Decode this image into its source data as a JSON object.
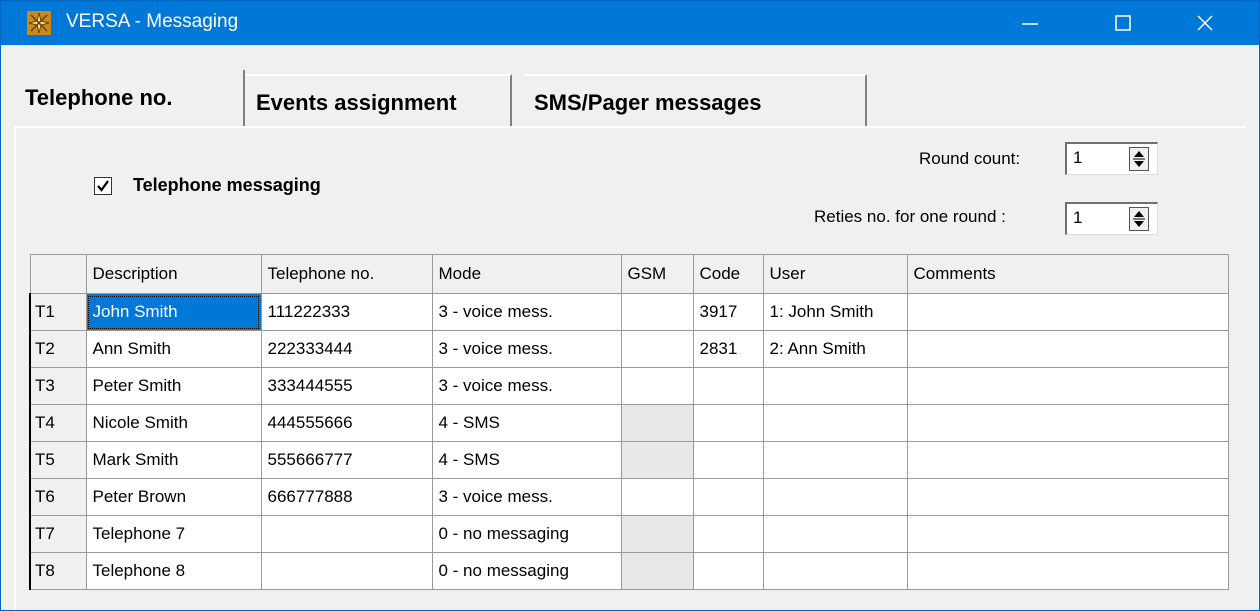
{
  "window": {
    "title": "VERSA - Messaging",
    "icon": "versa-app-icon",
    "controls": [
      "minimize-icon",
      "maximize-icon",
      "close-icon"
    ]
  },
  "tabs": [
    {
      "label": "Telephone no.",
      "active": true
    },
    {
      "label": "Events assignment",
      "active": false
    },
    {
      "label": "SMS/Pager messages",
      "active": false
    }
  ],
  "telephone_messaging": {
    "label": "Telephone messaging",
    "checked": true
  },
  "round_count": {
    "label": "Round count:",
    "value": "1"
  },
  "retries": {
    "label": "Reties no. for one round :",
    "value": "1"
  },
  "table": {
    "columns": [
      "",
      "Description",
      "Telephone no.",
      "Mode",
      "GSM",
      "Code",
      "User",
      "Comments"
    ],
    "rows": [
      {
        "id": "T1",
        "description": "John Smith",
        "phone": "111222333",
        "mode": "3 - voice mess.",
        "gsm": "",
        "code": "3917",
        "user": "1: John Smith",
        "comments": ""
      },
      {
        "id": "T2",
        "description": "Ann Smith",
        "phone": "222333444",
        "mode": "3 - voice mess.",
        "gsm": "",
        "code": "2831",
        "user": "2: Ann Smith",
        "comments": ""
      },
      {
        "id": "T3",
        "description": "Peter Smith",
        "phone": "333444555",
        "mode": "3 - voice mess.",
        "gsm": "",
        "code": "",
        "user": "",
        "comments": ""
      },
      {
        "id": "T4",
        "description": "Nicole Smith",
        "phone": "444555666",
        "mode": "4 - SMS",
        "gsm": "",
        "code": "",
        "user": "",
        "comments": ""
      },
      {
        "id": "T5",
        "description": "Mark Smith",
        "phone": "555666777",
        "mode": "4 - SMS",
        "gsm": "",
        "code": "",
        "user": "",
        "comments": ""
      },
      {
        "id": "T6",
        "description": "Peter Brown",
        "phone": "666777888",
        "mode": "3 - voice mess.",
        "gsm": "",
        "code": "",
        "user": "",
        "comments": ""
      },
      {
        "id": "T7",
        "description": "Telephone 7",
        "phone": "",
        "mode": "0 - no messaging",
        "gsm": "",
        "code": "",
        "user": "",
        "comments": ""
      },
      {
        "id": "T8",
        "description": "Telephone 8",
        "phone": "",
        "mode": "0 - no messaging",
        "gsm": "",
        "code": "",
        "user": "",
        "comments": ""
      }
    ]
  },
  "colors": {
    "titlebar": "#0078d7",
    "selection": "#0078d7",
    "dialog": "#f0f0f0"
  }
}
